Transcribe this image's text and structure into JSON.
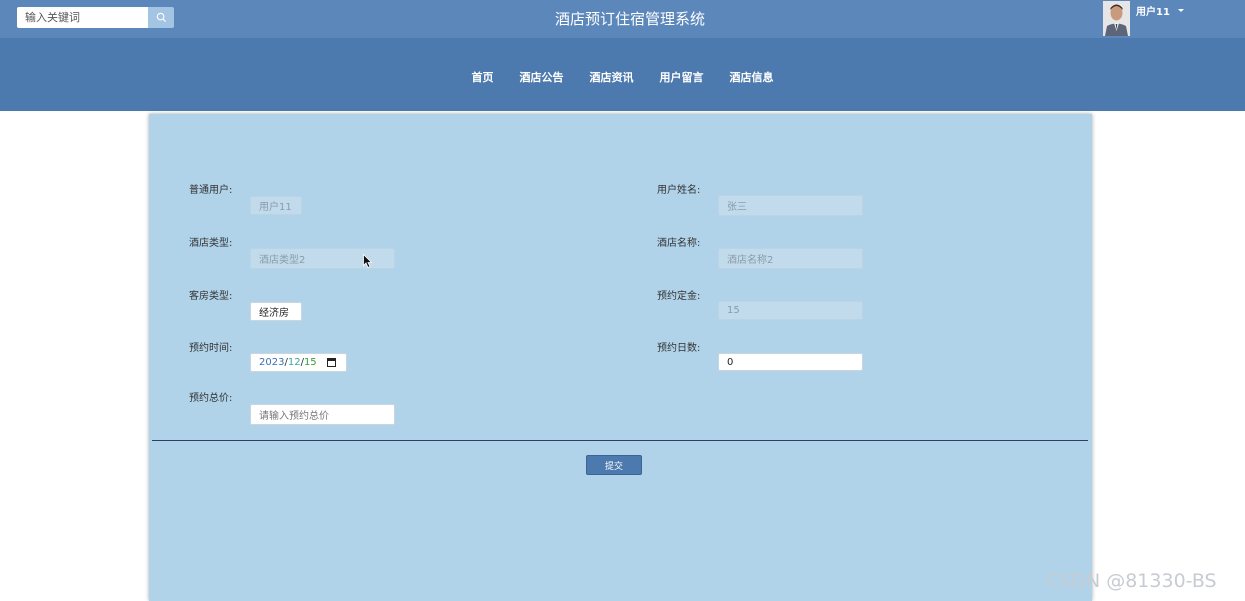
{
  "header": {
    "search": {
      "placeholder": "输入关键词",
      "icon": "search-icon"
    },
    "title": "酒店预订住宿管理系统",
    "user": {
      "name": "用户11",
      "avatar": "user-avatar"
    }
  },
  "nav": {
    "items": [
      {
        "label": "首页"
      },
      {
        "label": "酒店公告"
      },
      {
        "label": "酒店资讯"
      },
      {
        "label": "用户留言"
      },
      {
        "label": "酒店信息"
      }
    ]
  },
  "form": {
    "user_account": {
      "label": "普通用户:",
      "value": "用户11"
    },
    "user_realname": {
      "label": "用户姓名:",
      "value": "张三"
    },
    "hotel_type": {
      "label": "酒店类型:",
      "value": "酒店类型2"
    },
    "hotel_name": {
      "label": "酒店名称:",
      "value": "酒店名称2"
    },
    "room_type": {
      "label": "客房类型:",
      "value": "经济房"
    },
    "deposit": {
      "label": "预约定金:",
      "value": "15"
    },
    "booking_date": {
      "label": "预约时间:",
      "year": "2023",
      "month": "12",
      "day": "15",
      "sep": "/"
    },
    "booking_days": {
      "label": "预约日数:",
      "value": "0"
    },
    "total_price": {
      "label": "预约总价:",
      "placeholder": "请输入预约总价"
    },
    "submit_label": "提交"
  },
  "watermark": "CSDN @81330-BS",
  "colors": {
    "topbar": "#5b87bb",
    "navbar": "#4d7aae",
    "card": "#b0d3ea",
    "submit": "#4d7aae",
    "date_year": "#3d6fb5",
    "date_month": "#3aa7a2",
    "date_day": "#3a9a3a"
  }
}
